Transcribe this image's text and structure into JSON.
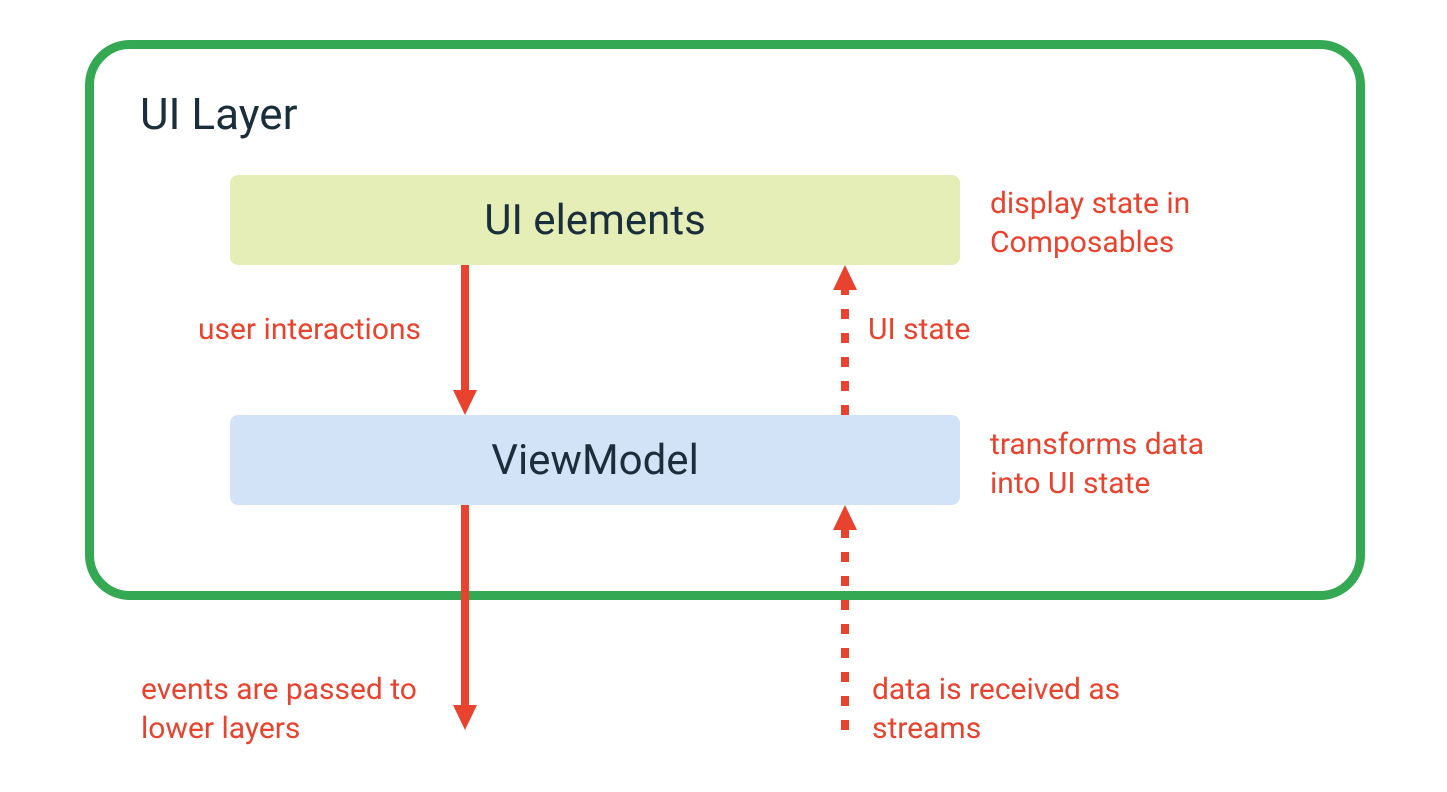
{
  "layer_title": "UI Layer",
  "boxes": {
    "ui_elements": "UI elements",
    "viewmodel": "ViewModel"
  },
  "annotations": {
    "display_state": "display state in Composables",
    "user_interactions": "user interactions",
    "ui_state": "UI state",
    "transforms": "transforms data into UI state",
    "events": "events are passed to lower layers",
    "data_received": "data is received as streams"
  },
  "colors": {
    "border": "#34a853",
    "ui_elements_bg": "#e6eeb8",
    "viewmodel_bg": "#d2e3f7",
    "text_dark": "#1a2e3b",
    "accent": "#e8432e"
  }
}
